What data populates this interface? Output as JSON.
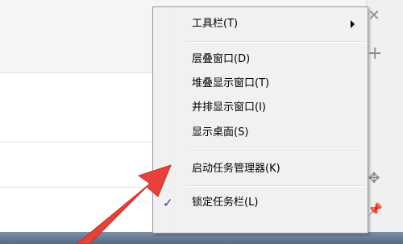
{
  "menu": {
    "items": [
      {
        "label": "工具栏(T)",
        "has_submenu": true
      },
      {
        "label": "层叠窗口(D)"
      },
      {
        "label": "堆叠显示窗口(T)"
      },
      {
        "label": "并排显示窗口(I)"
      },
      {
        "label": "显示桌面(S)"
      },
      {
        "label": "启动任务管理器(K)"
      },
      {
        "label": "锁定任务栏(L)",
        "checked": true
      }
    ]
  },
  "side_icons": [
    "close-icon",
    "plus-icon",
    "move-icon",
    "pin-icon"
  ],
  "colors": {
    "annotation_arrow": "#e8413a",
    "check": "#1f3f8f"
  }
}
